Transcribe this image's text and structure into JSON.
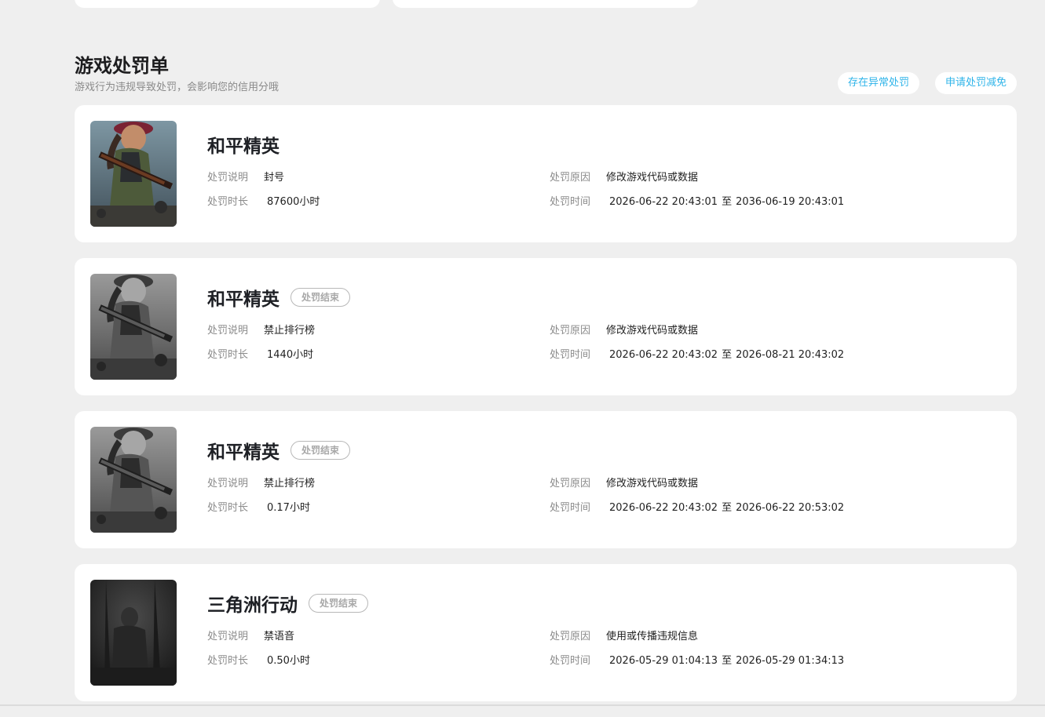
{
  "section": {
    "title": "游戏处罚单",
    "subtitle": "游戏行为违规导致处罚，会影响您的信用分哦",
    "actions": {
      "abnormal_label": "存在异常处罚",
      "appeal_label": "申请处罚减免"
    }
  },
  "labels": {
    "description": "处罚说明",
    "reason": "处罚原因",
    "duration": "处罚时长",
    "time": "处罚时间",
    "connector": "至"
  },
  "records": [
    {
      "game": "和平精英",
      "status": "",
      "description": "封号",
      "reason": "修改游戏代码或数据",
      "duration": "87600小时",
      "start": "2026-06-22 20:43:01",
      "end": "2036-06-19 20:43:01",
      "cover": "peace-elite-color"
    },
    {
      "game": "和平精英",
      "status": "处罚结束",
      "description": "禁止排行榜",
      "reason": "修改游戏代码或数据",
      "duration": "1440小时",
      "start": "2026-06-22 20:43:02",
      "end": "2026-08-21 20:43:02",
      "cover": "peace-elite-gray"
    },
    {
      "game": "和平精英",
      "status": "处罚结束",
      "description": "禁止排行榜",
      "reason": "修改游戏代码或数据",
      "duration": "0.17小时",
      "start": "2026-06-22 20:43:02",
      "end": "2026-06-22 20:53:02",
      "cover": "peace-elite-gray"
    },
    {
      "game": "三角洲行动",
      "status": "处罚结束",
      "description": "禁语音",
      "reason": "使用或传播违规信息",
      "duration": "0.50小时",
      "start": "2026-05-29 01:04:13",
      "end": "2026-05-29 01:34:13",
      "cover": "delta-force-gray"
    }
  ]
}
